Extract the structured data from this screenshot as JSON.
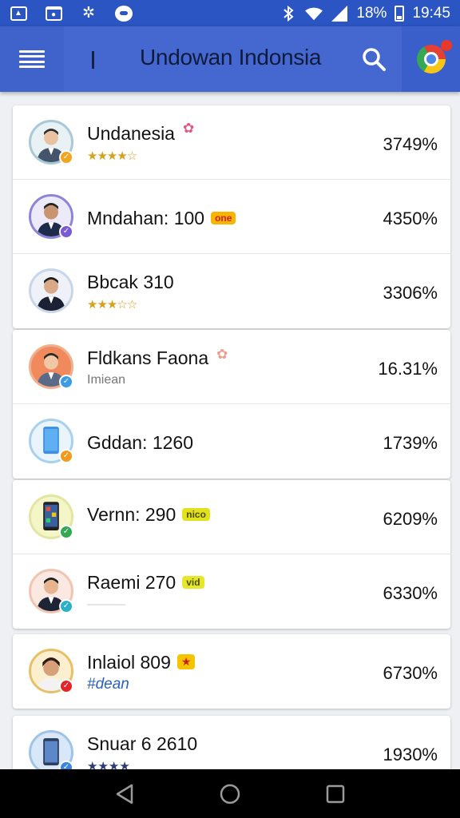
{
  "status_bar": {
    "left_icons": [
      "image-icon",
      "folder-icon",
      "pinwheel-icon",
      "message-icon"
    ],
    "right_icons": [
      "bluetooth-icon",
      "wifi-icon",
      "signal-icon"
    ],
    "battery_text": "18%",
    "time": "19:45"
  },
  "app_bar": {
    "title": "Undowan Indonsia",
    "menu_icon": "menu-icon",
    "search_icon": "search-icon",
    "browser_icon": "chrome-icon"
  },
  "items": [
    {
      "name": "Undanesia",
      "tag": "✿",
      "sub": "★★★★☆",
      "value": "3749%",
      "badge": "✓"
    },
    {
      "name": "Mndahan: 100",
      "tag": "one",
      "sub": "",
      "value": "4350%",
      "badge": "✓"
    },
    {
      "name": "Bbcak 310",
      "tag": "",
      "sub": "★★★☆☆",
      "value": "3306%",
      "badge": ""
    },
    {
      "name": "Fldkans Faona",
      "tag": "✿",
      "sub": "Imiean",
      "value": "16.31%",
      "badge": "✓"
    },
    {
      "name": "Gddan: 1260",
      "tag": "",
      "sub": "",
      "value": "1739%",
      "badge": "✓"
    },
    {
      "name": "Vernn: 290",
      "tag": "nico",
      "sub": "",
      "value": "6209%",
      "badge": "✓"
    },
    {
      "name": "Raemi 270",
      "tag": "vid",
      "sub": "———",
      "value": "6330%",
      "badge": "✓"
    },
    {
      "name": "Inlaiol 809",
      "tag": "★",
      "sub": "#dean",
      "value": "6730%",
      "badge": "✓"
    },
    {
      "name": "Snuar 6 2610",
      "tag": "",
      "sub": "★★★★",
      "value": "1930%",
      "badge": "✓"
    }
  ],
  "nav_bar": {
    "back_icon": "back-icon",
    "home_icon": "home-icon",
    "recents_icon": "recents-icon"
  },
  "colors": {
    "app_bar": "#4468cf",
    "status_bar": "#2a55c2",
    "background": "#eef0f3"
  }
}
